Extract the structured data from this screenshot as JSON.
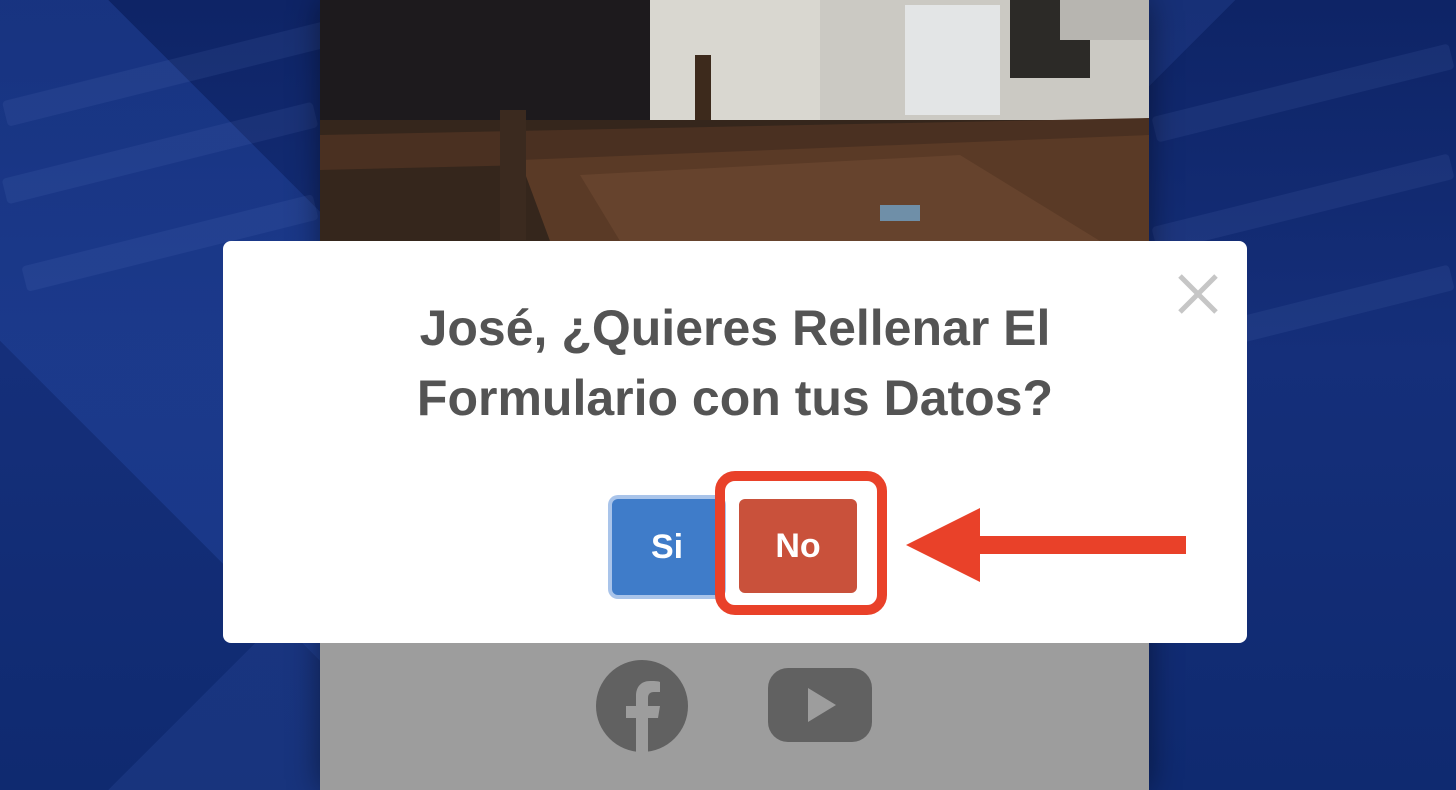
{
  "modal": {
    "title_line1": "José, ¿Quieres Rellenar El",
    "title_line2": "Formulario con tus Datos?",
    "close_icon": "close-icon",
    "yes_label": "Si",
    "no_label": "No"
  },
  "social": {
    "icons": [
      "facebook-icon",
      "youtube-icon"
    ]
  },
  "annotation": {
    "highlight_color": "#e94129",
    "arrow_icon": "arrow-left-icon"
  },
  "colors": {
    "yes_button": "#3f7cc9",
    "no_button": "#c9513b",
    "title_text": "#545454"
  }
}
